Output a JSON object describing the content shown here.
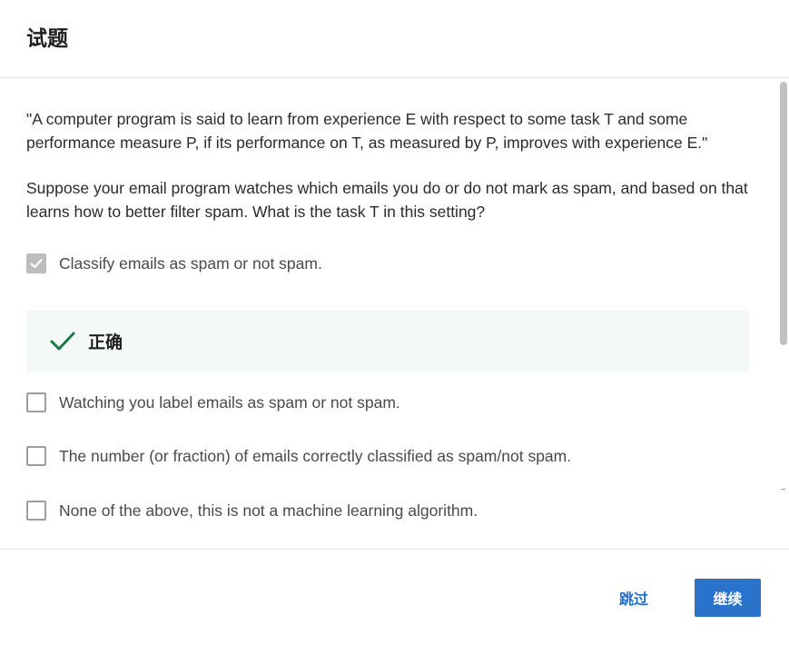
{
  "header": {
    "title": "试题"
  },
  "question": {
    "quote": "\"A computer program is said to learn from experience E with respect to some task T and some performance measure P, if its performance on T, as measured by P, improves with experience E.\"",
    "prompt": "Suppose your email program watches which emails you do or do not mark as spam, and based on that learns how to better filter spam. What is the task T in this setting?"
  },
  "options": [
    {
      "label": "Classify emails as spam or not spam.",
      "checked": true
    },
    {
      "label": "Watching you label emails as spam or not spam.",
      "checked": false
    },
    {
      "label": "The number (or fraction) of emails correctly classified as spam/not spam.",
      "checked": false
    },
    {
      "label": "None of the above, this is not a machine learning algorithm.",
      "checked": false
    }
  ],
  "feedback": {
    "label": "正确",
    "color": "#1e7a4c"
  },
  "footer": {
    "skip_label": "跳过",
    "continue_label": "继续"
  },
  "colors": {
    "accent": "#2a73cc",
    "link": "#1f6fd0",
    "correct": "#1e7a4c",
    "feedback_bg": "#f4f8f7"
  }
}
